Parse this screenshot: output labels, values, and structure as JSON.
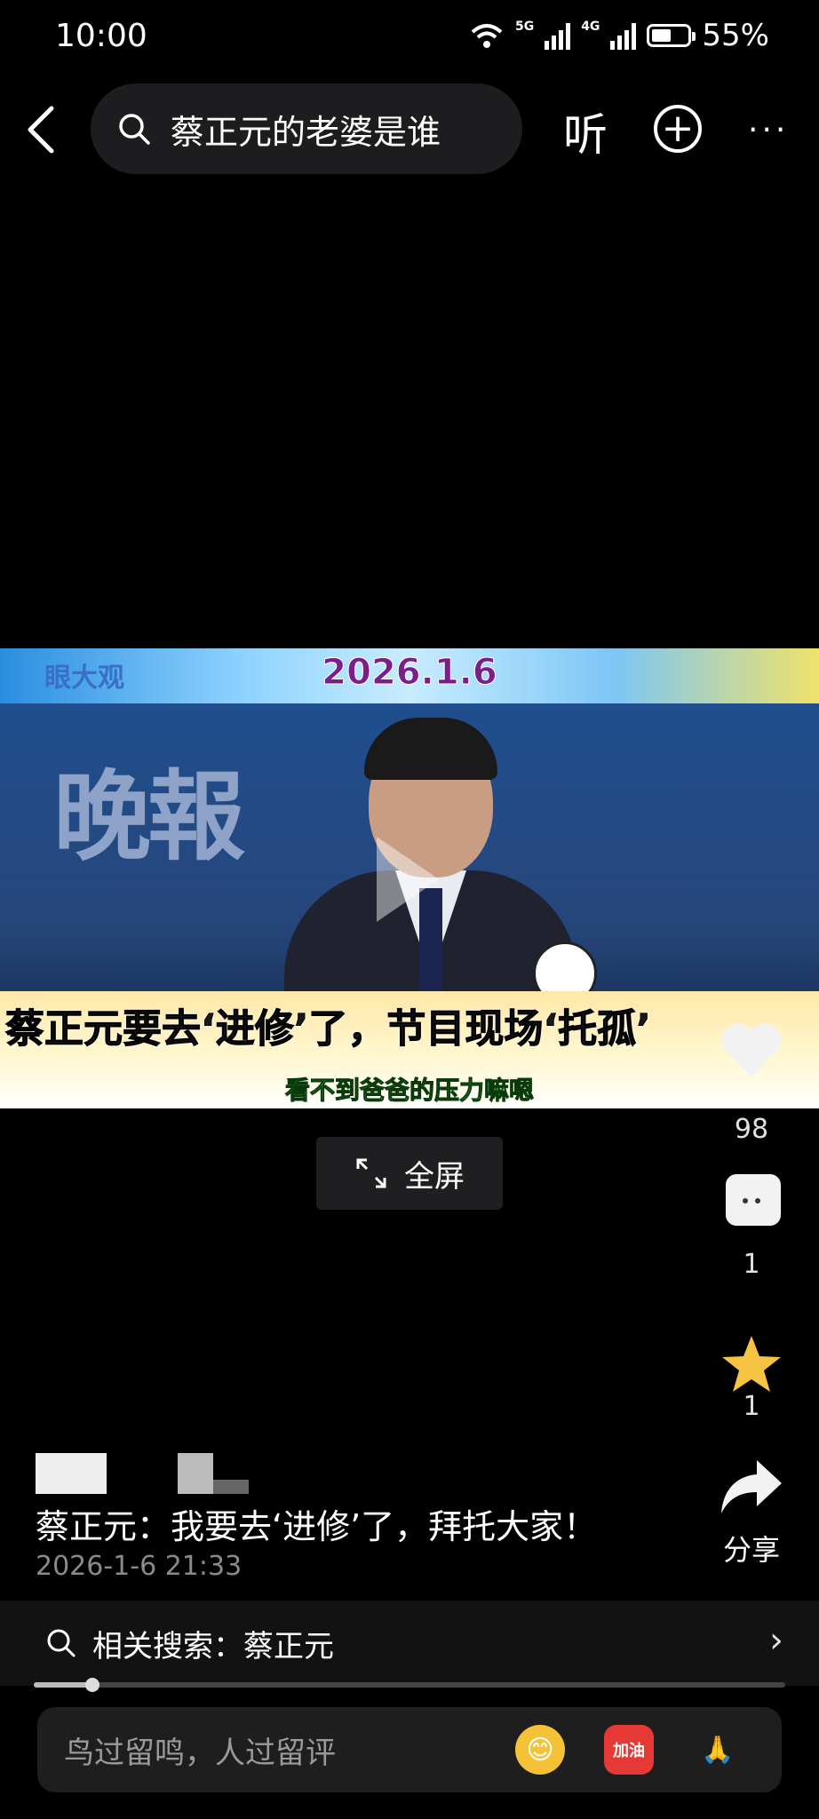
{
  "status_bar": {
    "time": "10:00",
    "net1": "5G",
    "net2": "4G",
    "battery": "55%",
    "battery_level": 0.55
  },
  "header": {
    "search_query": "蔡正元的老婆是谁",
    "listen_label": "听"
  },
  "video": {
    "date": "2026.1.6",
    "logo_text": "眼大观",
    "background_text": "晚報",
    "caption": "蔡正元要去‘进修’了，节目现场‘托孤’",
    "subtitle": "看不到爸爸的压力嘛嗯"
  },
  "fullscreen_label": "全屏",
  "rail": {
    "likes": "98",
    "comments": "1",
    "favorites": "1",
    "share": "分享"
  },
  "post": {
    "text": "蔡正元：我要去‘进修’了，拜托大家！",
    "time": "2026-1-6 21:33"
  },
  "related": {
    "label": "相关搜索：蔡正元"
  },
  "comment_bar": {
    "placeholder": "鸟过留鸣，人过留评",
    "emoji_cheer": "加油"
  },
  "colors": {
    "background": "#000000",
    "video_date": "#7a1e8c",
    "subtitle": "#4fd83a",
    "accent_red": "#e53935"
  }
}
